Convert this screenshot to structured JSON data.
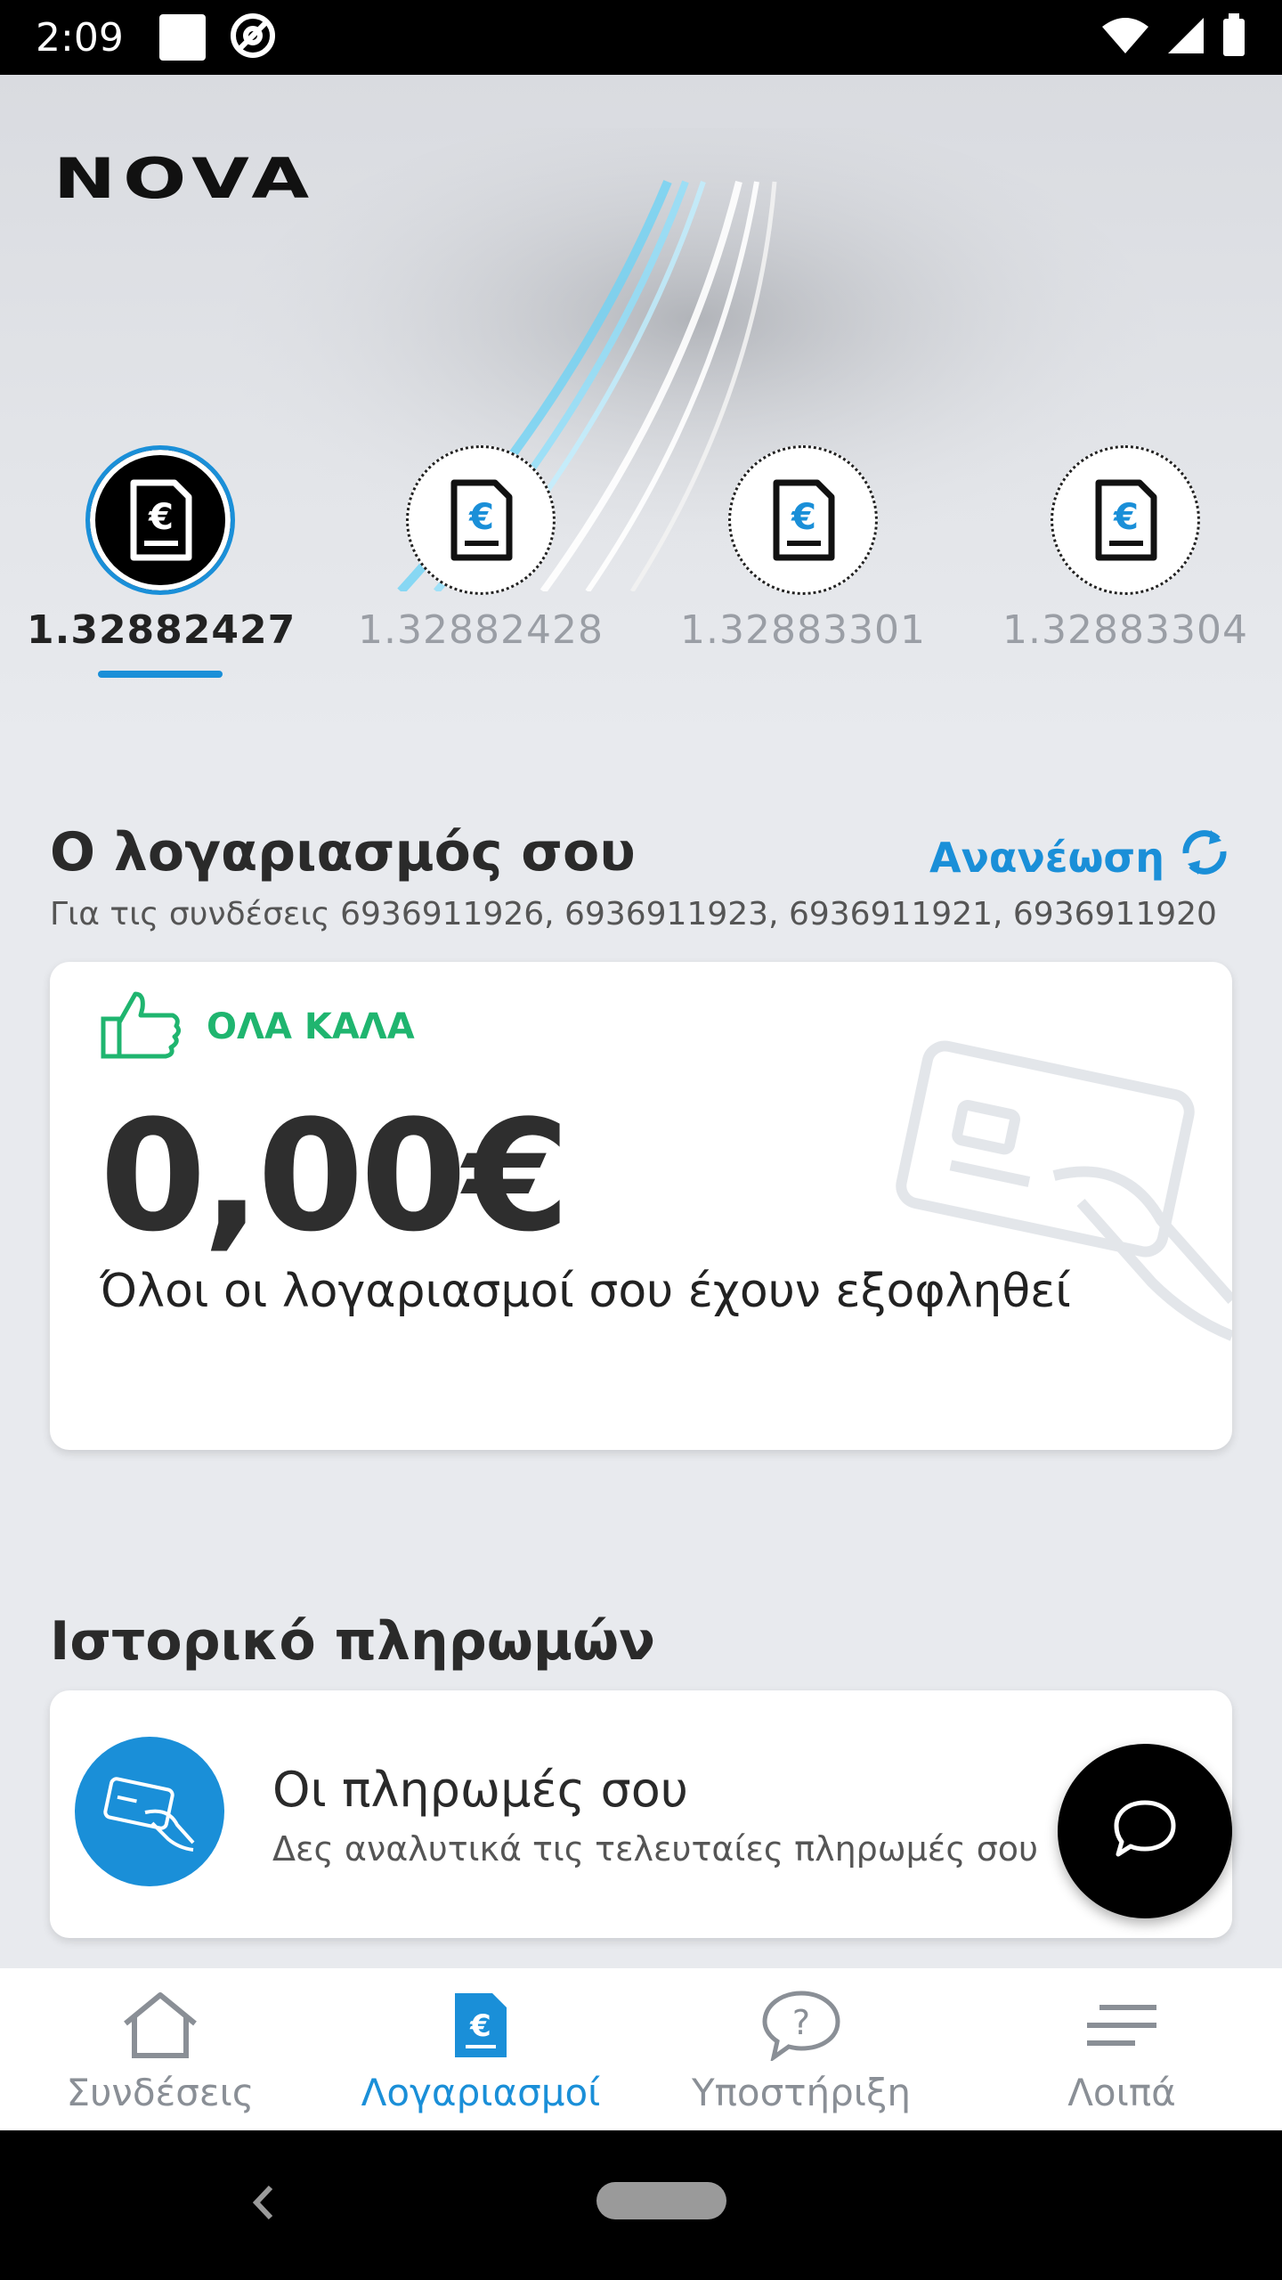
{
  "status_bar": {
    "time": "2:09"
  },
  "brand": {
    "logo_text": "NOVA"
  },
  "accounts": [
    {
      "label": "1.32882427",
      "active": true
    },
    {
      "label": "1.32882428",
      "active": false
    },
    {
      "label": "1.32883301",
      "active": false
    },
    {
      "label": "1.32883304",
      "active": false
    }
  ],
  "account_section": {
    "title": "Ο λογαριασμός σου",
    "refresh_label": "Ανανέωση",
    "subtitle": "Για τις συνδέσεις 6936911926, 6936911923, 6936911921, 6936911920",
    "status_label": "ΟΛΑ ΚΑΛΑ",
    "amount": "0,00€",
    "message": "Όλοι οι λογαριασμοί σου έχουν εξοφληθεί"
  },
  "payments_section": {
    "title": "Ιστορικό πληρωμών",
    "item_title": "Οι πληρωμές σου",
    "item_subtitle": "Δες αναλυτικά τις τελευταίες πληρωμές σου"
  },
  "bottom_nav": [
    {
      "label": "Συνδέσεις",
      "icon": "home-icon",
      "active": false
    },
    {
      "label": "Λογαριασμοί",
      "icon": "bill-icon",
      "active": true
    },
    {
      "label": "Υποστήριξη",
      "icon": "help-icon",
      "active": false
    },
    {
      "label": "Λοιπά",
      "icon": "menu-icon",
      "active": false
    }
  ],
  "colors": {
    "accent": "#1a8fd8",
    "ok_green": "#1fb56f",
    "background": "#e8eaee"
  }
}
